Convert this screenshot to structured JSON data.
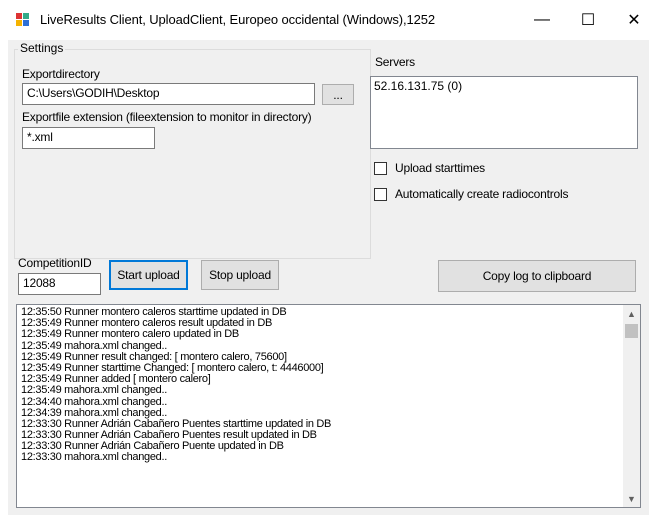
{
  "window": {
    "title": "LiveResults Client, UploadClient, Europeo occidental (Windows),1252",
    "minimize_glyph": "—",
    "maximize_glyph": "☐",
    "close_glyph": "✕",
    "app_icon": "liveresults-app-icon"
  },
  "settings": {
    "legend": "Settings",
    "export_directory_label": "Exportdirectory",
    "export_directory_value": "C:\\Users\\GODIH\\Desktop",
    "browse_label": "...",
    "extension_label": "Exportfile extension (fileextension to monitor in directory)",
    "extension_value": "*.xml"
  },
  "servers": {
    "label": "Servers",
    "items": [
      "52.16.131.75 (0)"
    ]
  },
  "options": {
    "upload_starttimes_label": "Upload starttimes",
    "upload_starttimes_checked": false,
    "auto_radiocontrols_label": "Automatically create radiocontrols",
    "auto_radiocontrols_checked": false
  },
  "competition": {
    "label": "CompetitionID",
    "value": "12088"
  },
  "buttons": {
    "start_upload": "Start upload",
    "stop_upload": "Stop upload",
    "copy_log": "Copy log to clipboard"
  },
  "log": {
    "lines": [
      "12:35:50 Runner  montero caleros starttime updated in DB",
      "12:35:49 Runner  montero caleros result updated in DB",
      "12:35:49 Runner  montero calero updated in DB",
      "12:35:49 mahora.xml changed..",
      "12:35:49 Runner result changed: [ montero calero, 75600]",
      "12:35:49 Runner starttime Changed: [ montero calero, t: 4446000]",
      "12:35:49 Runner added [ montero calero]",
      "12:35:49 mahora.xml changed..",
      "12:34:40 mahora.xml changed..",
      "12:34:39 mahora.xml changed..",
      "12:33:30 Runner Adrián Cabañero Puentes starttime updated in DB",
      "12:33:30 Runner Adrián Cabañero Puentes result updated in DB",
      "12:33:30 Runner Adrián Cabañero Puente updated in DB",
      "12:33:30 mahora.xml changed.."
    ],
    "scroll_up_glyph": "▲",
    "scroll_down_glyph": "▼"
  }
}
